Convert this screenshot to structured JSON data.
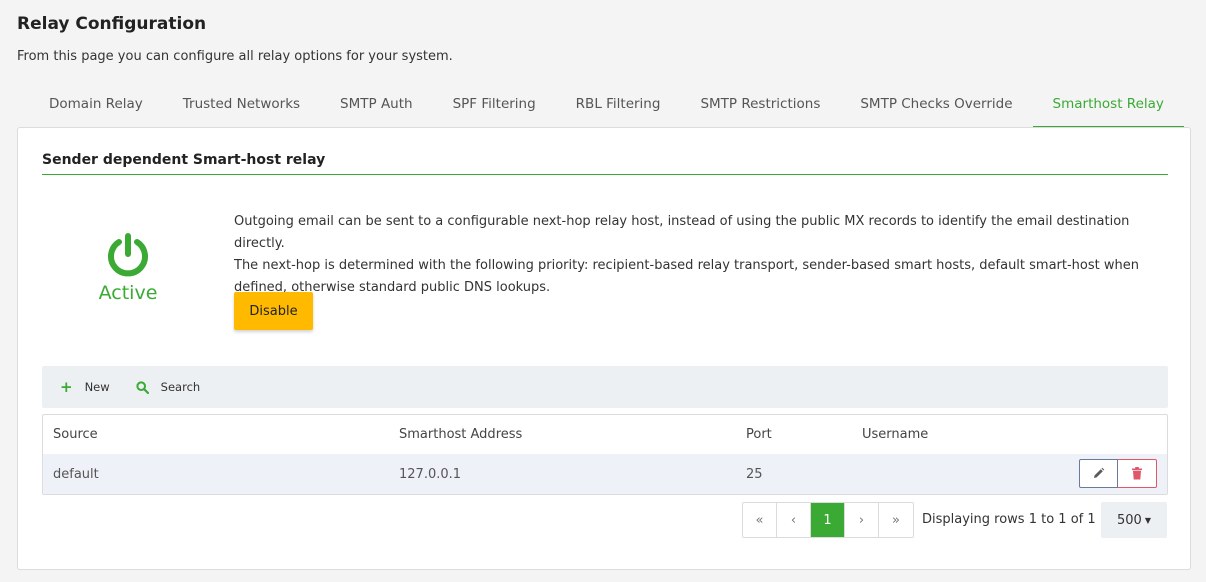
{
  "page": {
    "title": "Relay Configuration",
    "description": "From this page you can configure all relay options for your system."
  },
  "tabs": [
    {
      "label": "Domain Relay"
    },
    {
      "label": "Trusted Networks"
    },
    {
      "label": "SMTP Auth"
    },
    {
      "label": "SPF Filtering"
    },
    {
      "label": "RBL Filtering"
    },
    {
      "label": "SMTP Restrictions"
    },
    {
      "label": "SMTP Checks Override"
    },
    {
      "label": "Smarthost Relay",
      "active": true
    }
  ],
  "section": {
    "title": "Sender dependent Smart-host relay",
    "status_label": "Active",
    "status_icon": "power-icon",
    "description_line1": "Outgoing email can be sent to a configurable next-hop relay host, instead of using the public MX records to identify the email destination directly.",
    "description_line2": "The next-hop is determined with the following priority: recipient-based relay transport, sender-based smart hosts, default smart-host when defined, otherwise standard public DNS lookups.",
    "disable_label": "Disable"
  },
  "toolbar": {
    "new_label": "New",
    "search_label": "Search"
  },
  "table": {
    "headers": {
      "source": "Source",
      "address": "Smarthost Address",
      "port": "Port",
      "username": "Username"
    },
    "rows": [
      {
        "source": "default",
        "address": "127.0.0.1",
        "port": "25",
        "username": ""
      }
    ]
  },
  "pagination": {
    "first": "«",
    "prev": "‹",
    "current": "1",
    "next": "›",
    "last": "»",
    "info": "Displaying rows 1 to 1 of 1",
    "rows_per_page": "500"
  },
  "colors": {
    "accent": "#3aaa35",
    "warning": "#ffba00",
    "danger": "#e0566a"
  }
}
